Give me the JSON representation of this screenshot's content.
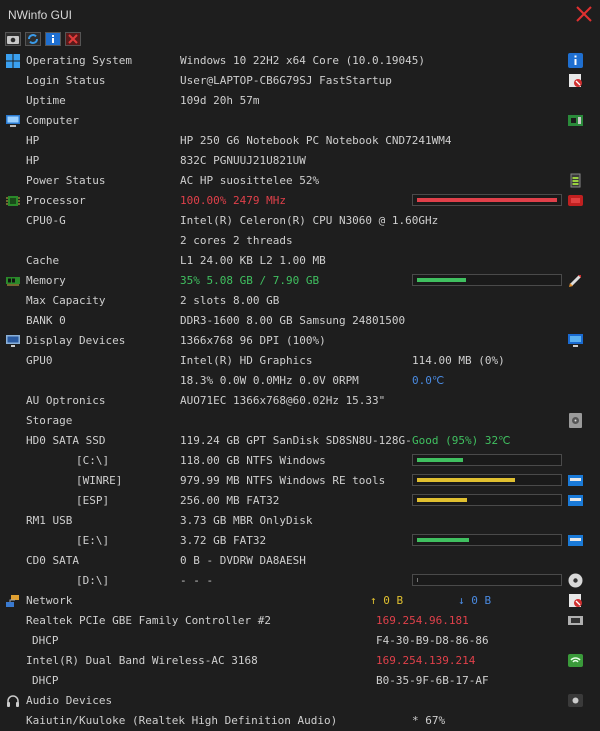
{
  "window": {
    "title": "NWinfo GUI"
  },
  "colors": {
    "background": "#1e1e1e",
    "text": "#cfcfcf",
    "red": "#e0404a",
    "green": "#40c060",
    "blue": "#4a8ae0",
    "yellow": "#e0c030"
  },
  "toolbar": [
    "camera-icon",
    "refresh-icon",
    "info-icon",
    "close-icon"
  ],
  "rows": [
    {
      "name": "os",
      "icon": "windows-icon",
      "label": "Operating System",
      "value": "Windows 10 22H2 x64 Core (10.0.19045)",
      "right_icon": "info-icon"
    },
    {
      "name": "login-status",
      "label": "Login Status",
      "value": "User@LAPTOP-CB6G79SJ FastStartup",
      "right_icon": "user-icon"
    },
    {
      "name": "uptime",
      "label": "Uptime",
      "value": "109d 20h 57m"
    },
    {
      "name": "computer",
      "icon": "computer-icon",
      "label": "Computer",
      "right_icon": "board-icon"
    },
    {
      "name": "hp-model",
      "label": "HP",
      "value": "HP 250 G6 Notebook PC Notebook CND7241WM4"
    },
    {
      "name": "hp-board",
      "label": "HP",
      "value": "832C PGNUUJ21U821UW"
    },
    {
      "name": "power-status",
      "label": "Power Status",
      "value": "AC  HP suosittelee 52%",
      "right_icon": "battery-icon"
    },
    {
      "name": "processor",
      "icon": "processor-icon",
      "label": "Processor",
      "value": "100.00% 2479 MHz",
      "value_color": "red",
      "bar": {
        "fraction": 1.0,
        "color": "red"
      },
      "right_icon": "cpu-red-icon"
    },
    {
      "name": "cpu0",
      "label": "CPU0-G",
      "value": "Intel(R) Celeron(R) CPU  N3060  @ 1.60GHz"
    },
    {
      "name": "cpu-cores",
      "label": "",
      "value": "2 cores 2 threads"
    },
    {
      "name": "cache",
      "label": "Cache",
      "value": "L1 24.00 KB L2 1.00 MB"
    },
    {
      "name": "memory",
      "icon": "memory-icon",
      "label": "Memory",
      "value": "35% 5.08 GB / 7.90 GB",
      "value_color": "green",
      "bar": {
        "fraction": 0.35,
        "color": "green"
      },
      "right_icon": "rocket-icon"
    },
    {
      "name": "max-capacity",
      "label": "Max Capacity",
      "value": "2 slots 8.00 GB"
    },
    {
      "name": "bank0",
      "label": "BANK 0",
      "value": "DDR3-1600 8.00 GB Samsung 24801500"
    },
    {
      "name": "display",
      "icon": "display-icon",
      "label": "Display Devices",
      "value": "1366x768 96 DPI (100%)",
      "right_icon": "monitor-icon"
    },
    {
      "name": "gpu0",
      "label": "GPU0",
      "value": "Intel(R) HD Graphics",
      "value2": "114.00 MB (0%)"
    },
    {
      "name": "gpu-stats",
      "label": "",
      "value": "18.3% 0.0W 0.0MHz 0.0V 0RPM",
      "value2": "0.0℃",
      "value2_color": "blue"
    },
    {
      "name": "panel",
      "label": "AU Optronics",
      "value": "AUO71EC 1366x768@60.02Hz 15.33\""
    },
    {
      "name": "storage",
      "icon": "storage-icon",
      "label": "Storage",
      "right_icon": "disk-icon"
    },
    {
      "name": "hd0",
      "label": "HD0 SATA SSD",
      "value": "119.24 GB GPT SanDisk SD8SN8U-128G-",
      "value2": "Good (95%) 32℃",
      "value2_color": "green"
    },
    {
      "name": "vol-c",
      "label": "[C:\\]",
      "indent": true,
      "value": "118.00 GB NTFS Windows",
      "bar": {
        "fraction": 0.33,
        "color": "green"
      },
      "right_icon": "windows-icon"
    },
    {
      "name": "vol-winre",
      "label": "[WINRE]",
      "indent": true,
      "value": "979.99 MB NTFS Windows RE tools",
      "bar": {
        "fraction": 0.7,
        "color": "yellow"
      },
      "right_icon": "drive-icon"
    },
    {
      "name": "vol-esp",
      "label": "[ESP]",
      "indent": true,
      "value": "256.00 MB FAT32",
      "bar": {
        "fraction": 0.36,
        "color": "yellow"
      },
      "right_icon": "drive-icon"
    },
    {
      "name": "rm1",
      "label": "RM1 USB",
      "value": "3.73 GB MBR OnlyDisk"
    },
    {
      "name": "vol-e",
      "label": "[E:\\]",
      "indent": true,
      "value": "3.72 GB FAT32",
      "bar": {
        "fraction": 0.37,
        "color": "green"
      },
      "right_icon": "drive-icon"
    },
    {
      "name": "cd0",
      "label": "CD0 SATA",
      "value": "0 B - DVDRW  DA8AESH"
    },
    {
      "name": "vol-d",
      "label": "[D:\\]",
      "indent": true,
      "value": "- - -",
      "bar": {
        "fraction": 0.0,
        "color": "green"
      },
      "right_icon": "optical-icon"
    },
    {
      "name": "network",
      "icon": "network-icon",
      "label": "Network",
      "value2": "↑ 0 B",
      "value2_color": "yellow",
      "value3": "↓ 0 B",
      "value3_color": "blue",
      "right_icon": "net-off-icon"
    },
    {
      "name": "nic-realtek",
      "label": "Realtek PCIe GBE Family Controller #2",
      "value2": "169.254.96.181",
      "value2_color": "red",
      "right_icon": "ethernet-icon"
    },
    {
      "name": "dhcp1",
      "label": "DHCP",
      "small_indent": true,
      "value2": "F4-30-B9-D8-86-86"
    },
    {
      "name": "nic-intel",
      "label": "Intel(R) Dual Band Wireless-AC 3168",
      "value2": "169.254.139.214",
      "value2_color": "red",
      "right_icon": "wifi-icon"
    },
    {
      "name": "dhcp2",
      "label": "DHCP",
      "small_indent": true,
      "value2": "B0-35-9F-6B-17-AF"
    },
    {
      "name": "audio",
      "icon": "headphones-icon",
      "label": "Audio Devices",
      "right_icon": "speaker-icon"
    },
    {
      "name": "kuuloke",
      "label": "Kaiutin/Kuuloke (Realtek High Definition Audio)",
      "value2": "* 67%"
    }
  ]
}
